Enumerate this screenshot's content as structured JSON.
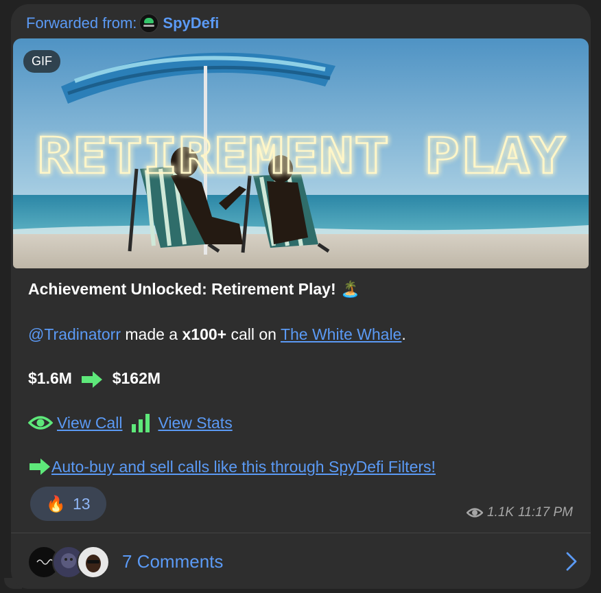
{
  "forward": {
    "prefix": "Forwarded from:",
    "channel": "SpyDefi"
  },
  "media": {
    "badge": "GIF",
    "overlay_text": "RETIREMENT PLAY"
  },
  "message": {
    "title": "Achievement Unlocked: Retirement Play!",
    "title_emoji": "🏝️",
    "mention": "@Tradinatorr",
    "made_a": " made a ",
    "multiplier": "x100+",
    "call_on": " call on ",
    "token_link": "The White Whale",
    "period": ".",
    "mc_from": "$1.6M",
    "mc_to": "$162M",
    "view_call": "View Call",
    "view_stats": "View Stats",
    "autobuy_link": "Auto-buy and sell calls like this through SpyDefi Filters!"
  },
  "reaction": {
    "emoji": "🔥",
    "count": "13"
  },
  "meta": {
    "views": "1.1K",
    "time": "11:17 PM"
  },
  "comments": {
    "label": "7 Comments"
  },
  "colors": {
    "accent": "#5b9af5",
    "green": "#5ee87a",
    "bubble": "#2e2e2e"
  }
}
